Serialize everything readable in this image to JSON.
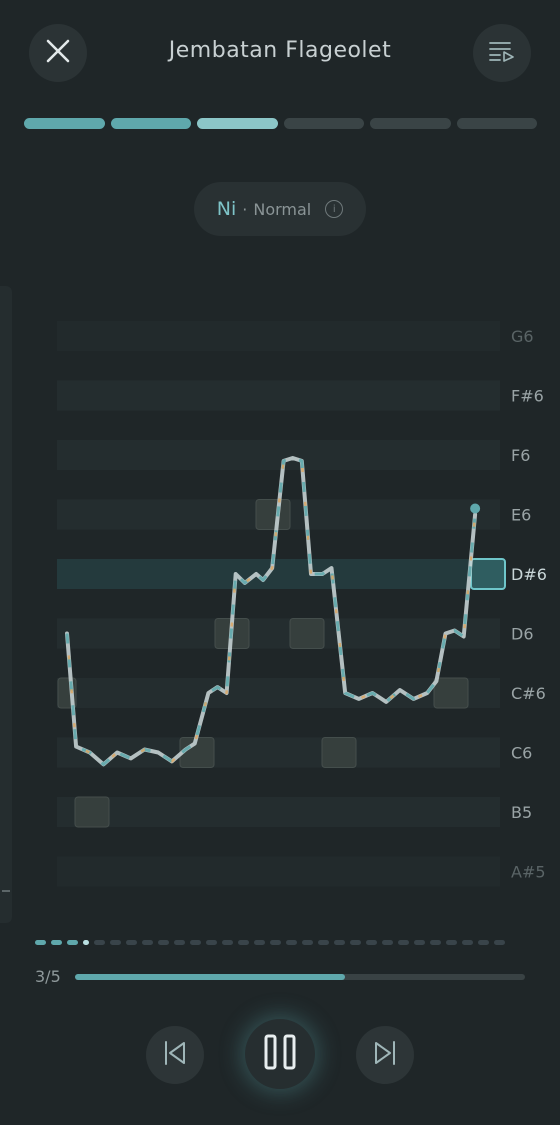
{
  "header": {
    "title": "Jembatan Flageolet",
    "close_icon": "close-icon",
    "queue_icon": "playlist-play-icon"
  },
  "segments": [
    {
      "state": "done"
    },
    {
      "state": "done"
    },
    {
      "state": "current"
    },
    {
      "state": "pending"
    },
    {
      "state": "pending"
    },
    {
      "state": "pending"
    }
  ],
  "mode_pill": {
    "note": "Ni",
    "separator": "·",
    "mode": "Normal",
    "info_icon": "info-icon"
  },
  "colors": {
    "accent": "#5fa8ac",
    "warm": "#d9a86a",
    "line": "#c4d0d2"
  },
  "chart_data": {
    "type": "line",
    "note_labels": [
      "G6",
      "F#6",
      "F6",
      "E6",
      "D#6",
      "D6",
      "C#6",
      "C6",
      "B5",
      "A#5"
    ],
    "active_note": "D#6",
    "target_notes": [
      "C#6",
      "B5",
      "C6",
      "D6",
      "E6",
      "D6",
      "C6",
      "C#6",
      "D#6"
    ],
    "pitch_trace_semitones": [
      [
        0,
        3
      ],
      [
        0.4,
        1.1
      ],
      [
        1.0,
        1.0
      ],
      [
        1.6,
        0.8
      ],
      [
        2.2,
        1.0
      ],
      [
        2.8,
        0.9
      ],
      [
        3.4,
        1.05
      ],
      [
        4.0,
        1.0
      ],
      [
        4.6,
        0.85
      ],
      [
        5.2,
        1.05
      ],
      [
        5.6,
        1.15
      ],
      [
        6.2,
        2.0
      ],
      [
        6.6,
        2.1
      ],
      [
        7.0,
        2.0
      ],
      [
        7.4,
        4.0
      ],
      [
        7.8,
        3.85
      ],
      [
        8.3,
        4.0
      ],
      [
        8.6,
        3.9
      ],
      [
        9.0,
        4.1
      ],
      [
        9.5,
        5.9
      ],
      [
        9.9,
        5.95
      ],
      [
        10.3,
        5.9
      ],
      [
        10.7,
        4.0
      ],
      [
        11.2,
        4.0
      ],
      [
        11.6,
        4.1
      ],
      [
        12.2,
        2.0
      ],
      [
        12.8,
        1.9
      ],
      [
        13.4,
        2.0
      ],
      [
        14.0,
        1.85
      ],
      [
        14.6,
        2.05
      ],
      [
        15.2,
        1.9
      ],
      [
        15.8,
        2.0
      ],
      [
        16.2,
        2.2
      ],
      [
        16.6,
        3.0
      ],
      [
        17.0,
        3.05
      ],
      [
        17.4,
        2.95
      ],
      [
        17.9,
        5.0
      ]
    ]
  },
  "sentence_dots": {
    "total": 30,
    "done": 3,
    "current": 4
  },
  "progress": {
    "label": "3/5",
    "fraction": 0.6
  },
  "controls": {
    "prev_icon": "skip-previous-icon",
    "play_icon": "pause-icon",
    "next_icon": "skip-next-icon"
  }
}
